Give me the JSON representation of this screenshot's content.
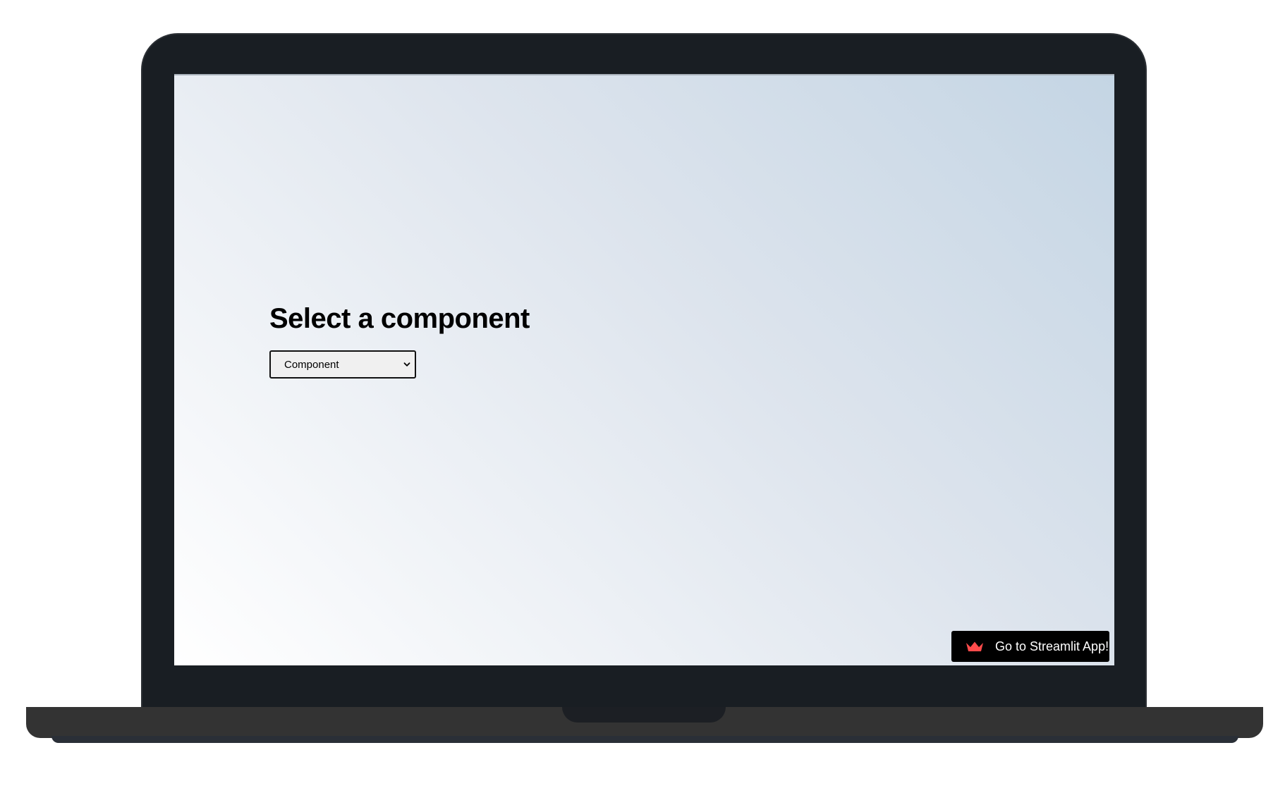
{
  "main": {
    "title": "Select a component",
    "component_select": {
      "selected": "Component"
    }
  },
  "footer_button": {
    "label": "Go to Streamlit App!",
    "icon": "crown-icon",
    "icon_color": "#ff4b4b"
  },
  "colors": {
    "bezel": "#191e23",
    "base": "#333333",
    "gradient_light": "#ffffff",
    "gradient_dark": "#c4d5e4"
  }
}
